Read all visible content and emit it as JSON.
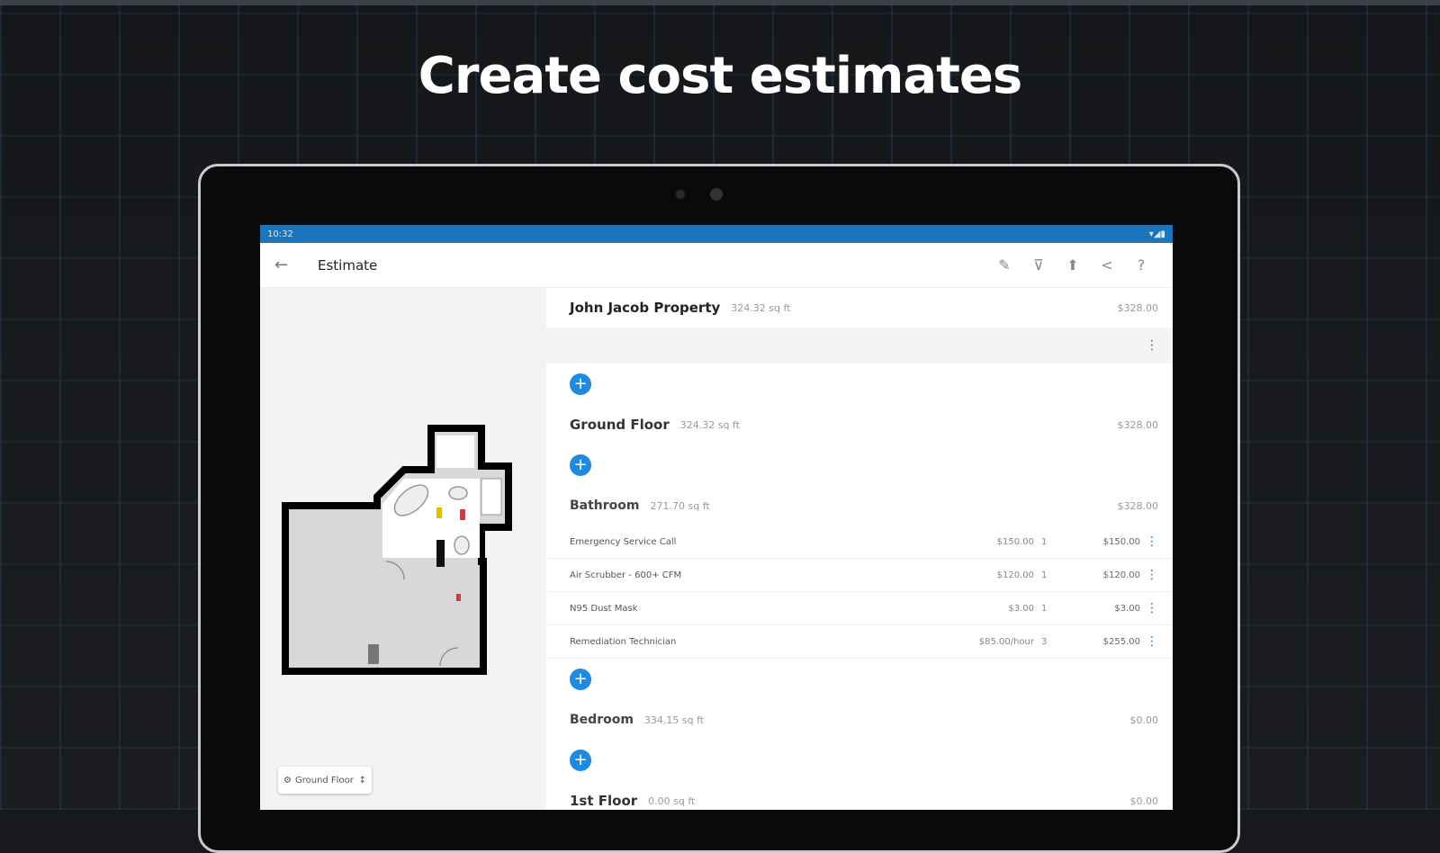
{
  "headline": "Create cost estimates",
  "status": {
    "time": "10:32",
    "icons": "▾◢▮"
  },
  "appbar": {
    "back_icon": "←",
    "title": "Estimate",
    "actions": [
      {
        "name": "edit-icon",
        "glyph": "✎"
      },
      {
        "name": "filter-icon",
        "glyph": "⊽"
      },
      {
        "name": "export-icon",
        "glyph": "⬆"
      },
      {
        "name": "share-icon",
        "glyph": "<"
      },
      {
        "name": "help-icon",
        "glyph": "?"
      }
    ]
  },
  "floor_selector": {
    "icon": "⚙",
    "label": "Ground Floor",
    "arrow": "↕"
  },
  "estimate": {
    "property": {
      "name": "John Jacob Property",
      "area": "324.32 sq ft",
      "amount": "$328.00"
    },
    "ground_floor": {
      "name": "Ground Floor",
      "area": "324.32 sq ft",
      "amount": "$328.00"
    },
    "bathroom": {
      "name": "Bathroom",
      "area": "271.70 sq ft",
      "amount": "$328.00"
    },
    "items": [
      {
        "name": "Emergency Service Call",
        "rate": "$150.00",
        "qty": "1",
        "total": "$150.00"
      },
      {
        "name": "Air Scrubber - 600+ CFM",
        "rate": "$120.00",
        "qty": "1",
        "total": "$120.00"
      },
      {
        "name": "N95 Dust Mask",
        "rate": "$3.00",
        "qty": "1",
        "total": "$3.00"
      },
      {
        "name": "Remediation Technician",
        "rate": "$85.00/hour",
        "qty": "3",
        "total": "$255.00"
      }
    ],
    "bedroom": {
      "name": "Bedroom",
      "area": "334.15 sq ft",
      "amount": "$0.00"
    },
    "first_floor": {
      "name": "1st Floor",
      "area": "0.00 sq ft",
      "amount": "$0.00"
    }
  },
  "plus_glyph": "+",
  "more_glyph": "⋮"
}
